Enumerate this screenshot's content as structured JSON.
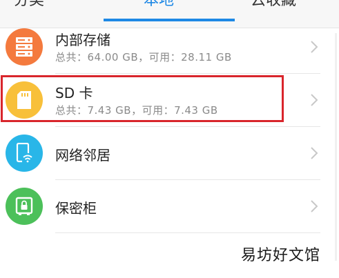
{
  "tabs": [
    {
      "label": "分类"
    },
    {
      "label": "本地",
      "active": true
    },
    {
      "label": "云收藏"
    }
  ],
  "items": [
    {
      "title": "内部存储",
      "subtitle": "总共：64.00 GB，可用：28.11 GB",
      "icon": "storage-server-icon",
      "icon_color": "#f47a3e"
    },
    {
      "title": "SD 卡",
      "subtitle": "总共：7.43 GB，可用：7.43 GB",
      "icon": "sd-card-icon",
      "icon_color": "#f8c03a",
      "highlighted": true
    },
    {
      "title": "网络邻居",
      "icon": "phone-wifi-icon",
      "icon_color": "#29b6e8"
    },
    {
      "title": "保密柜",
      "icon": "safe-lock-icon",
      "icon_color": "#4cc05a"
    }
  ],
  "highlight_color": "#d9252b",
  "accent_color": "#1e88e5",
  "watermark": "易坊好文馆"
}
